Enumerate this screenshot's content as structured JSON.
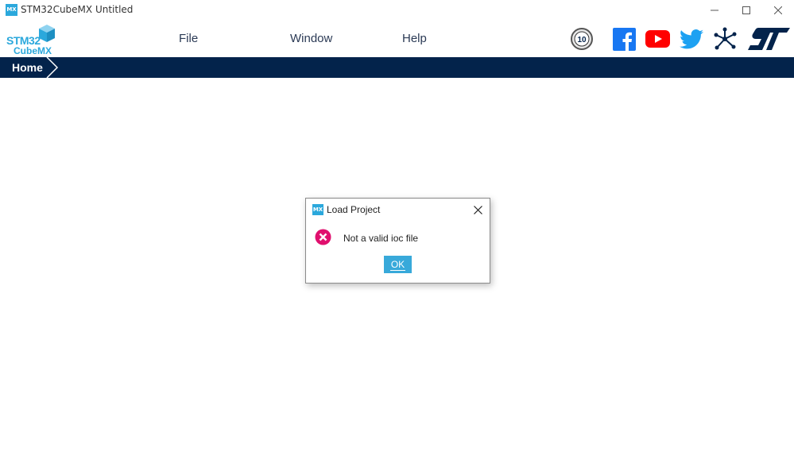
{
  "window": {
    "title": "STM32CubeMX Untitled",
    "app_icon_text": "MX"
  },
  "logo": {
    "line1": "STM32",
    "line2": "CubeMX"
  },
  "menu": {
    "file": "File",
    "window": "Window",
    "help": "Help"
  },
  "header_icons": [
    "anniversary-10-icon",
    "facebook-icon",
    "youtube-icon",
    "twitter-icon",
    "network-icon",
    "st-logo-icon"
  ],
  "nav": {
    "home": "Home"
  },
  "dialog": {
    "icon_text": "MX",
    "title": "Load Project",
    "message": "Not a valid ioc file",
    "ok_label": "OK",
    "badge_text": "10"
  },
  "colors": {
    "accent": "#2ba8dc",
    "navbar": "#03234b",
    "facebook": "#1877f2",
    "youtube": "#ff0000",
    "twitter": "#1da1f2",
    "error": "#e0106e"
  }
}
